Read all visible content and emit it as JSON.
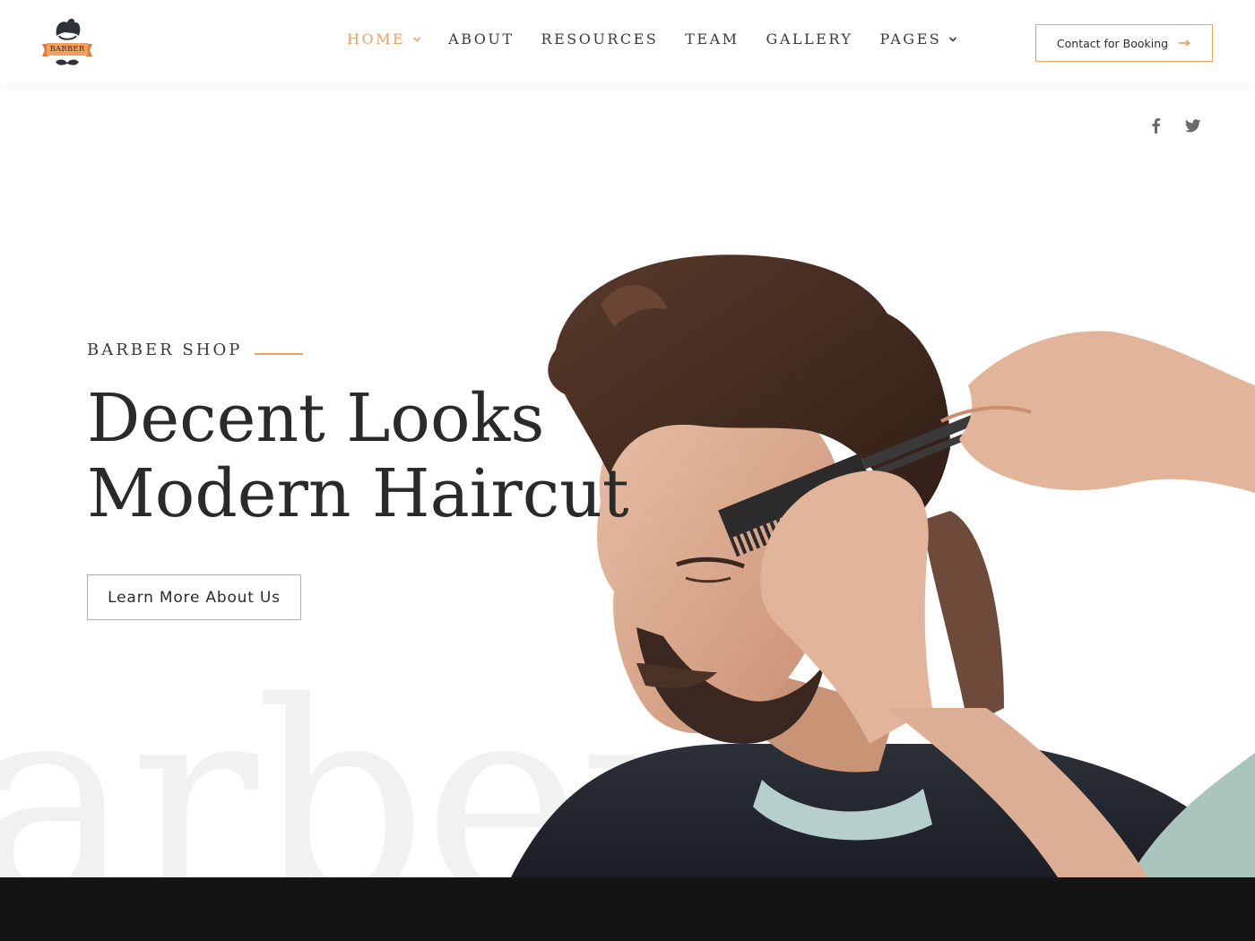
{
  "brand": {
    "logo_text": "BARBER",
    "accent": "#f0a160"
  },
  "nav": {
    "items": [
      {
        "label": "HOME",
        "active": true,
        "has_dropdown": true
      },
      {
        "label": "ABOUT",
        "active": false,
        "has_dropdown": false
      },
      {
        "label": "RESOURCES",
        "active": false,
        "has_dropdown": false
      },
      {
        "label": "TEAM",
        "active": false,
        "has_dropdown": false
      },
      {
        "label": "GALLERY",
        "active": false,
        "has_dropdown": false
      },
      {
        "label": "PAGES",
        "active": false,
        "has_dropdown": true
      }
    ]
  },
  "header": {
    "cta_label": "Contact for Booking",
    "cta_icon": "arrow-right-icon"
  },
  "social": {
    "icons": [
      "facebook-icon",
      "twitter-icon"
    ]
  },
  "hero": {
    "eyebrow": "BARBER SHOP",
    "title_line1": "Decent Looks",
    "title_line2": "Modern Haircut",
    "button_label": "Learn More About Us",
    "watermark": "arber"
  }
}
